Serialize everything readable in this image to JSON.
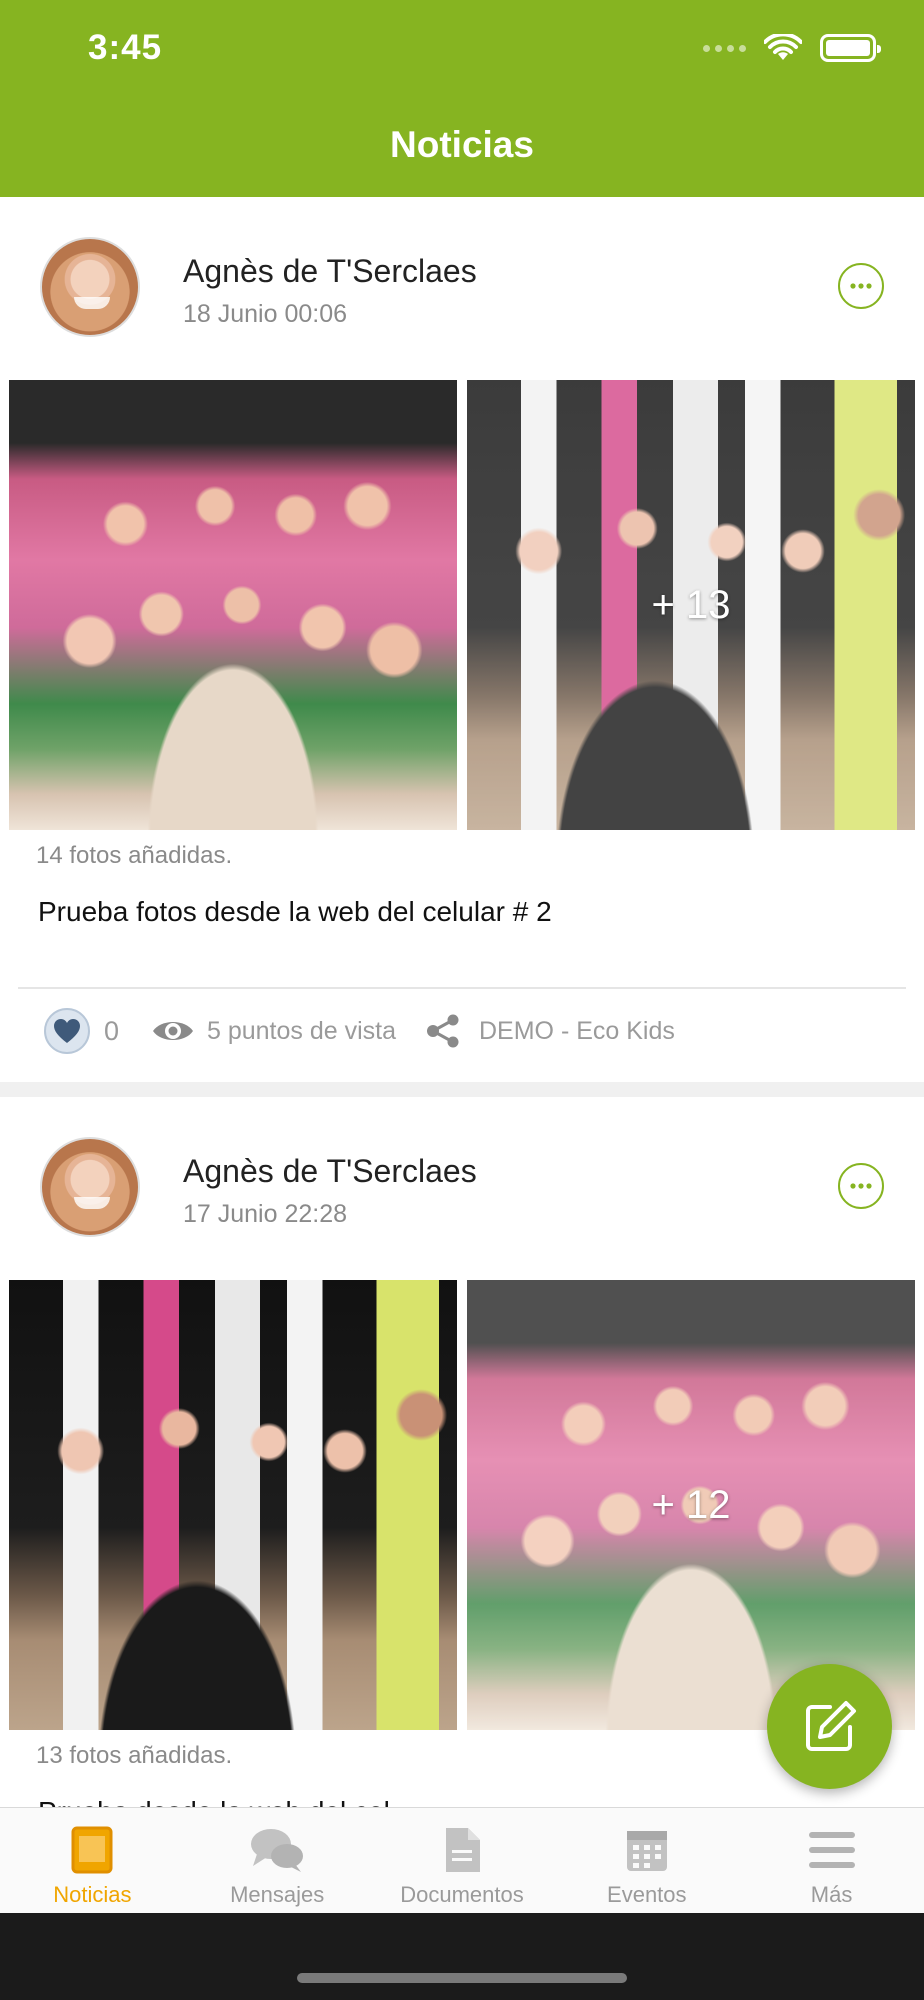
{
  "status_bar": {
    "time": "3:45"
  },
  "header": {
    "title": "Noticias"
  },
  "posts": [
    {
      "author": "Agnès de T'Serclaes",
      "date": "18 Junio 00:06",
      "photo_overlay": "+ 13",
      "photos_count": "14 fotos añadidas.",
      "text": "Prueba fotos desde la web del celular # 2",
      "likes": "0",
      "views": "5 puntos de vista",
      "channel": "DEMO - Eco Kids"
    },
    {
      "author": "Agnès de T'Serclaes",
      "date": "17 Junio 22:28",
      "photo_overlay": "+ 12",
      "photos_count": "13 fotos añadidas.",
      "text": "Prueba desde la web del cel"
    }
  ],
  "tabs": [
    {
      "label": "Noticias",
      "icon": "news-icon",
      "active": true
    },
    {
      "label": "Mensajes",
      "icon": "chat-icon"
    },
    {
      "label": "Documentos",
      "icon": "document-icon"
    },
    {
      "label": "Eventos",
      "icon": "calendar-icon"
    },
    {
      "label": "Más",
      "icon": "menu-icon"
    }
  ],
  "colors": {
    "brand": "#86b421",
    "active_tab": "#f0a500",
    "muted": "#9a9a9a"
  }
}
